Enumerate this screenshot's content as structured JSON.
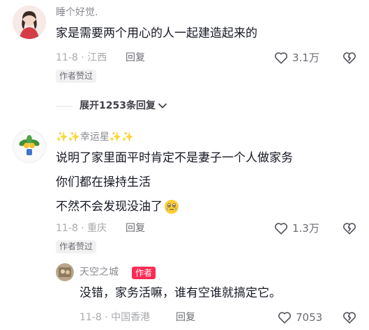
{
  "comments": [
    {
      "username": "睡个好觉.",
      "text": "家是需要两个用心的人一起建造起来的",
      "date": "11-8",
      "location": "江西",
      "reply_label": "回复",
      "likes": "3.1万",
      "badge": "作者赞过",
      "expand_label": "展开1253条回复"
    },
    {
      "username": "✨✨幸运星✨✨",
      "text_lines": [
        "说明了家里面平时肯定不是妻子一个人做家务",
        "你们都在操持生活",
        "不然不会发现没油了"
      ],
      "date": "11-8",
      "location": "重庆",
      "reply_label": "回复",
      "likes": "1.3万",
      "badge": "作者赞过",
      "reply": {
        "username": "天空之城",
        "author_tag": "作者",
        "text": "没错，家务活嘛，谁有空谁就搞定它。",
        "date": "11-8",
        "location": "中国香港",
        "reply_label": "回复",
        "likes": "7053"
      }
    }
  ],
  "meta_separator": "·",
  "icons": {
    "like": "heart-outline-icon",
    "dislike": "broken-heart-icon",
    "expand": "chevron-down-icon",
    "emoji": "crying-face-emoji-icon"
  },
  "colors": {
    "author_tag": "#fe2c55",
    "text": "#161823",
    "muted": "#a8a9ad"
  }
}
